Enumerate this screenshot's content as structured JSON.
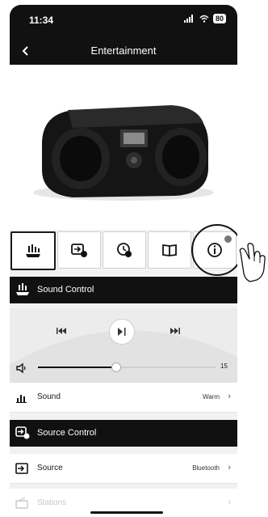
{
  "status_bar": {
    "time": "11:34",
    "battery": "80"
  },
  "nav": {
    "title": "Entertainment"
  },
  "tabs": [
    {
      "icon": "sound-control-icon",
      "active": true
    },
    {
      "icon": "source-control-icon",
      "active": false
    },
    {
      "icon": "timer-icon",
      "active": false
    },
    {
      "icon": "book-icon",
      "active": false
    },
    {
      "icon": "info-icon",
      "active": false,
      "badge": true
    }
  ],
  "sound_control": {
    "header": "Sound Control",
    "volume": {
      "value": "15",
      "fill_fraction": 0.44
    }
  },
  "sound_row": {
    "label": "Sound",
    "value": "Warm"
  },
  "source_control": {
    "header": "Source Control"
  },
  "source_row": {
    "label": "Source",
    "value": "Bluetooth"
  },
  "stations_row": {
    "label": "Stations"
  },
  "colors": {
    "header_bg": "#111111",
    "accent": "#1a1a1a"
  }
}
